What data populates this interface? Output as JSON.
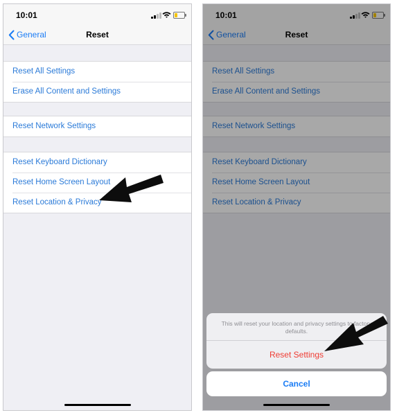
{
  "status": {
    "time": "10:01"
  },
  "nav": {
    "back_label": "General",
    "title": "Reset"
  },
  "groups": [
    [
      "Reset All Settings",
      "Erase All Content and Settings"
    ],
    [
      "Reset Network Settings"
    ],
    [
      "Reset Keyboard Dictionary",
      "Reset Home Screen Layout",
      "Reset Location & Privacy"
    ]
  ],
  "action_sheet": {
    "message": "This will reset your location and privacy settings to factory defaults.",
    "confirm_label": "Reset Settings",
    "cancel_label": "Cancel"
  },
  "colors": {
    "link_blue": "#2a7ad8",
    "destructive_red": "#ef3b32",
    "background": "#efeff4",
    "battery_yellow": "#f5c400"
  },
  "icons": [
    "signal-icon",
    "wifi-icon",
    "battery-icon",
    "chevron-left-icon",
    "arrow-annotation-icon"
  ]
}
